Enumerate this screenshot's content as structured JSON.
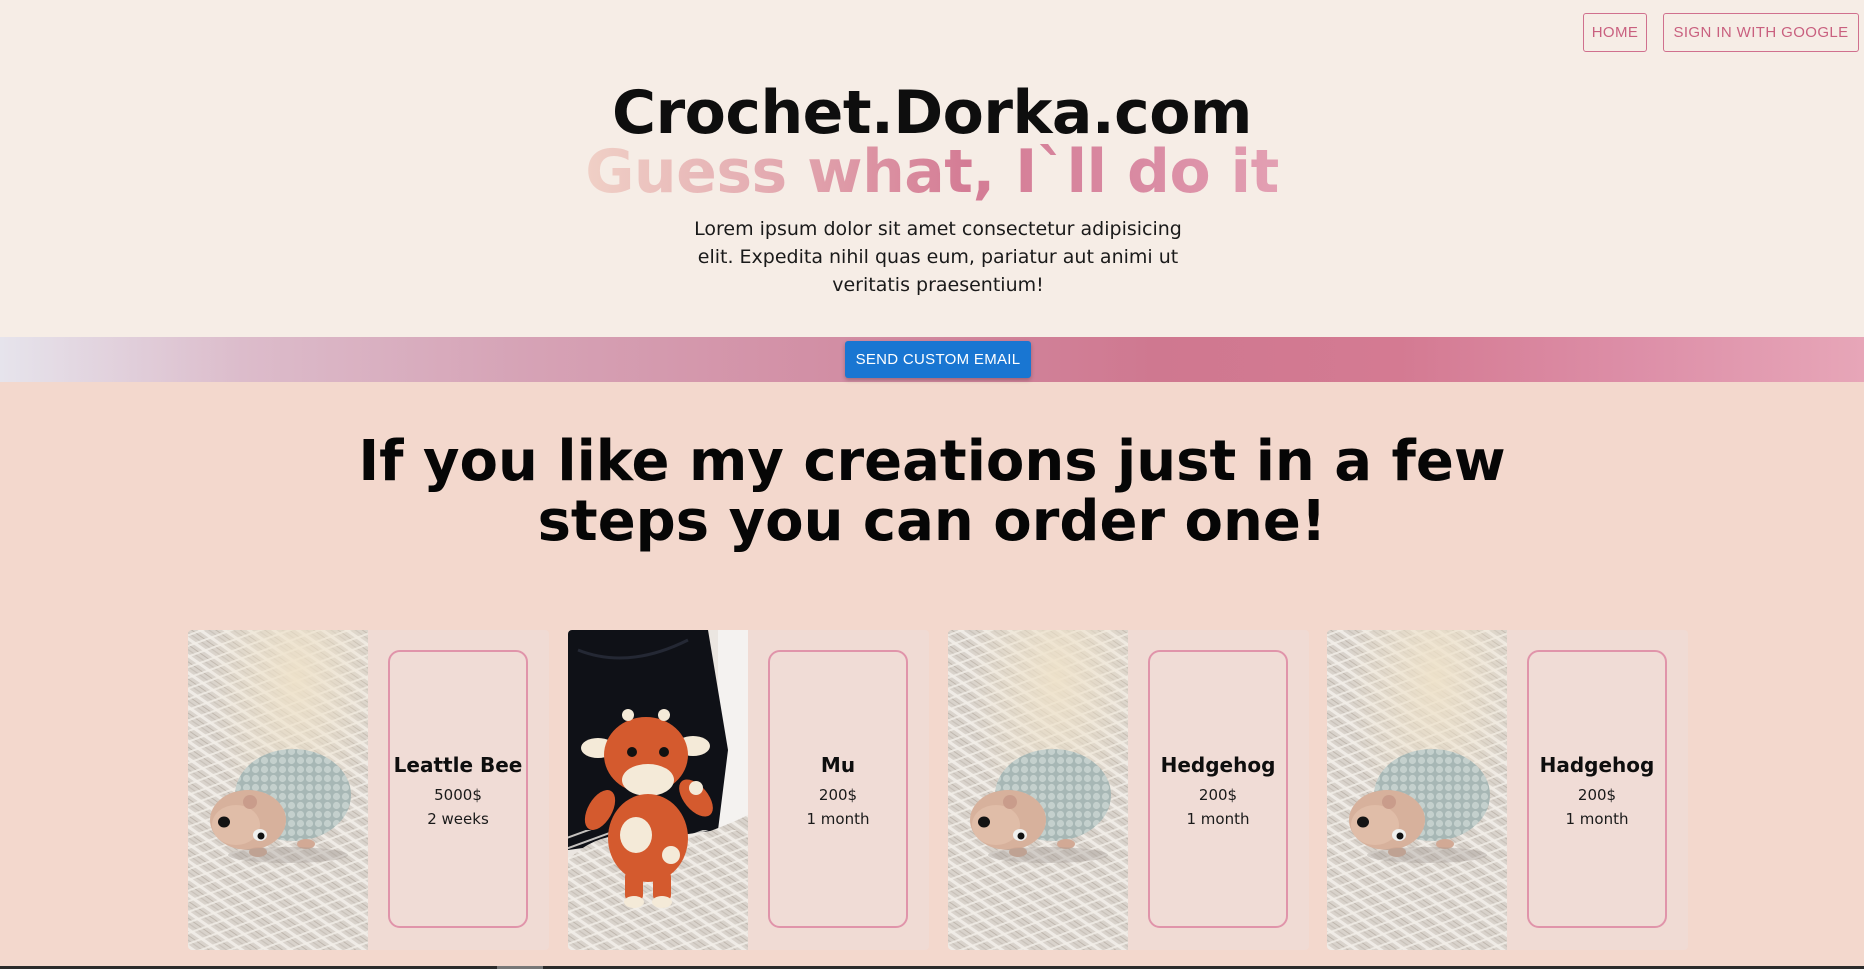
{
  "nav": {
    "home_label": "HOME",
    "signin_label": "SIGN IN WITH GOOGLE"
  },
  "hero": {
    "title": "Crochet.Dorka.com",
    "tagline": "Guess what, I`ll do it",
    "intro": "Lorem ipsum dolor sit amet consectetur adipisicing elit. Expedita nihil quas eum, pariatur aut animi ut veritatis praesentium!"
  },
  "actions": {
    "email_label": "SEND CUSTOM EMAIL"
  },
  "section": {
    "heading": "If you like my creations just in a few steps you can order one!"
  },
  "products": [
    {
      "name": "Leattle Bee",
      "price": "5000$",
      "time": "2 weeks",
      "photo": "hedgehog-plush-photo"
    },
    {
      "name": "Mu",
      "price": "200$",
      "time": "1 month",
      "photo": "cow-plush-photo"
    },
    {
      "name": "Hedgehog",
      "price": "200$",
      "time": "1 month",
      "photo": "hedgehog-plush-photo"
    },
    {
      "name": "Hadgehog",
      "price": "200$",
      "time": "1 month",
      "photo": "hedgehog-plush-photo"
    }
  ],
  "colors": {
    "hero_bg": "#f6ede6",
    "page_bg": "#f3d8cd",
    "accent_pink": "#d0708e",
    "button_blue": "#1976d2"
  }
}
